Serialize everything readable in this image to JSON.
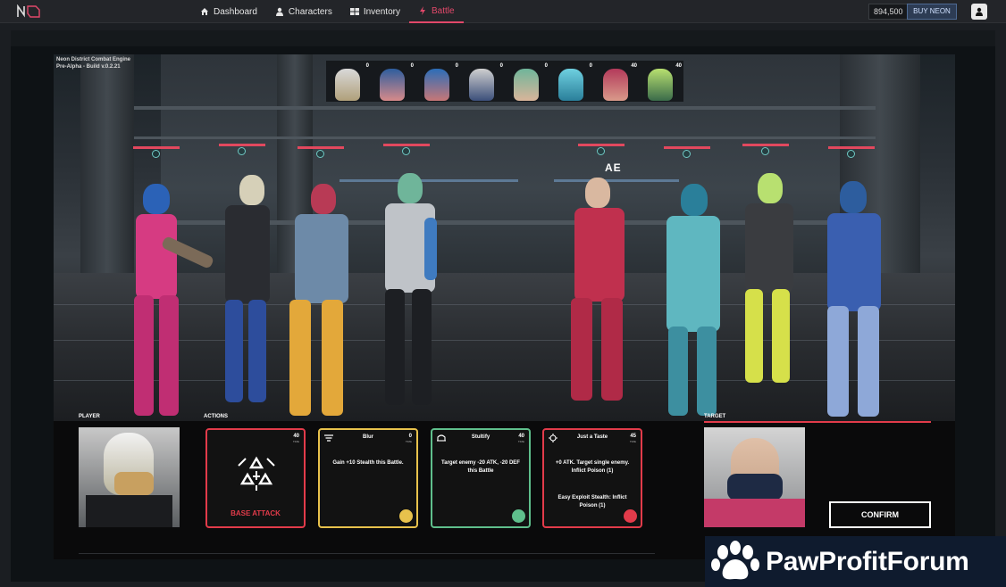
{
  "nav": {
    "items": [
      {
        "label": "Dashboard",
        "icon": "home-icon",
        "active": false
      },
      {
        "label": "Characters",
        "icon": "person-icon",
        "active": false
      },
      {
        "label": "Inventory",
        "icon": "grid-icon",
        "active": false
      },
      {
        "label": "Battle",
        "icon": "bolt-icon",
        "active": true
      }
    ],
    "balance": "894,500",
    "buy_label": "BUY NEON",
    "accent_color": "#e2486a"
  },
  "scene": {
    "engine_label_line1": "Neon District Combat Engine",
    "engine_label_line2": "Pre-Alpha - Build v.0.2.21",
    "sign": "AE",
    "turn_order": [
      {
        "value": "0"
      },
      {
        "value": "0"
      },
      {
        "value": "0"
      },
      {
        "value": "0"
      },
      {
        "value": "0"
      },
      {
        "value": "0"
      },
      {
        "value": "40"
      },
      {
        "value": "40"
      }
    ]
  },
  "panel": {
    "player_label": "PLAYER",
    "actions_label": "ACTIONS",
    "target_label": "TARGET",
    "confirm_label": "CONFIRM"
  },
  "cards": [
    {
      "name": "",
      "cost": "40",
      "cost_unit": "TIME",
      "desc": "",
      "desc2": "",
      "footer": "BASE ATTACK",
      "border": "#e23b4a",
      "dot": ""
    },
    {
      "name": "Blur",
      "cost": "0",
      "cost_unit": "TIME",
      "desc": "Gain +10 Stealth this Battle.",
      "desc2": "",
      "border": "#e8c24c",
      "dot": "#e8c24c"
    },
    {
      "name": "Stultify",
      "cost": "40",
      "cost_unit": "TIME",
      "desc": "Target enemy -20 ATK, -20 DEF this Battle",
      "desc2": "",
      "border": "#5fbf8c",
      "dot": "#5fbf8c"
    },
    {
      "name": "Just a Taste",
      "cost": "45",
      "cost_unit": "TIME",
      "desc": "+0 ATK. Target single enemy. Inflict Poison (1)",
      "desc2": "Easy Exploit Stealth: Inflict Poison (1)",
      "border": "#e23b4a",
      "dot": "#e23b4a"
    }
  ],
  "watermark": {
    "text": "PawProfitForum"
  }
}
